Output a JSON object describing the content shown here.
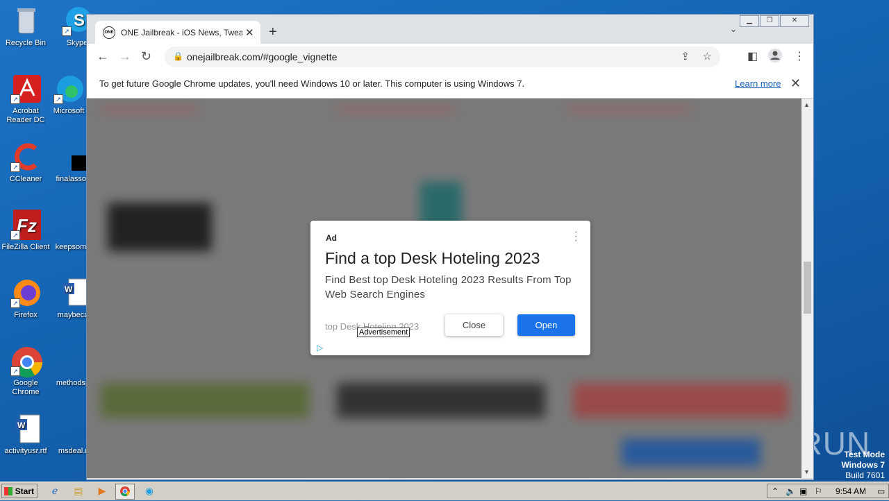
{
  "desktop": {
    "icons": [
      {
        "label": "Recycle Bin",
        "icon": "recycle-bin-icon"
      },
      {
        "label": "Skype",
        "icon": "skype-icon"
      },
      {
        "label": "Acrobat Reader DC",
        "icon": "acrobat-icon"
      },
      {
        "label": "Microsoft",
        "icon": "edge-icon"
      },
      {
        "label": "CCleaner",
        "icon": "ccleaner-icon"
      },
      {
        "label": "finalassoc",
        "icon": "black-file-icon"
      },
      {
        "label": "FileZilla Client",
        "icon": "filezilla-icon"
      },
      {
        "label": "keepsome",
        "icon": "blank-file-icon"
      },
      {
        "label": "Firefox",
        "icon": "firefox-icon"
      },
      {
        "label": "maybeca",
        "icon": "word-doc-icon"
      },
      {
        "label": "Google Chrome",
        "icon": "chrome-icon"
      },
      {
        "label": "methodsp",
        "icon": "blank-file-icon"
      },
      {
        "label": "activityusr.rtf",
        "icon": "word-doc-icon"
      },
      {
        "label": "msdeal.r",
        "icon": "blank-file-icon"
      }
    ]
  },
  "browser": {
    "tab_title": "ONE Jailbreak - iOS News, Tweaks an",
    "favicon_text": "ONE",
    "url": "onejailbreak.com/#google_vignette",
    "infobar_message": "To get future Google Chrome updates, you'll need Windows 10 or later. This computer is using Windows 7.",
    "infobar_link": "Learn more"
  },
  "ad": {
    "label": "Ad",
    "headline": "Find a top Desk Hoteling 2023",
    "description": "Find Best top Desk Hoteling 2023 Results From Top Web Search Engines",
    "site": "top Desk Hoteling 2023",
    "tooltip": "Advertisement",
    "close_label": "Close",
    "open_label": "Open",
    "open_color": "#1a73e8"
  },
  "watermark": "ANY RUN",
  "test_mode": {
    "line1": "Test Mode",
    "line2": "Windows 7",
    "line3": "Build 7601"
  },
  "taskbar": {
    "start_label": "Start",
    "clock": "9:54 AM"
  }
}
